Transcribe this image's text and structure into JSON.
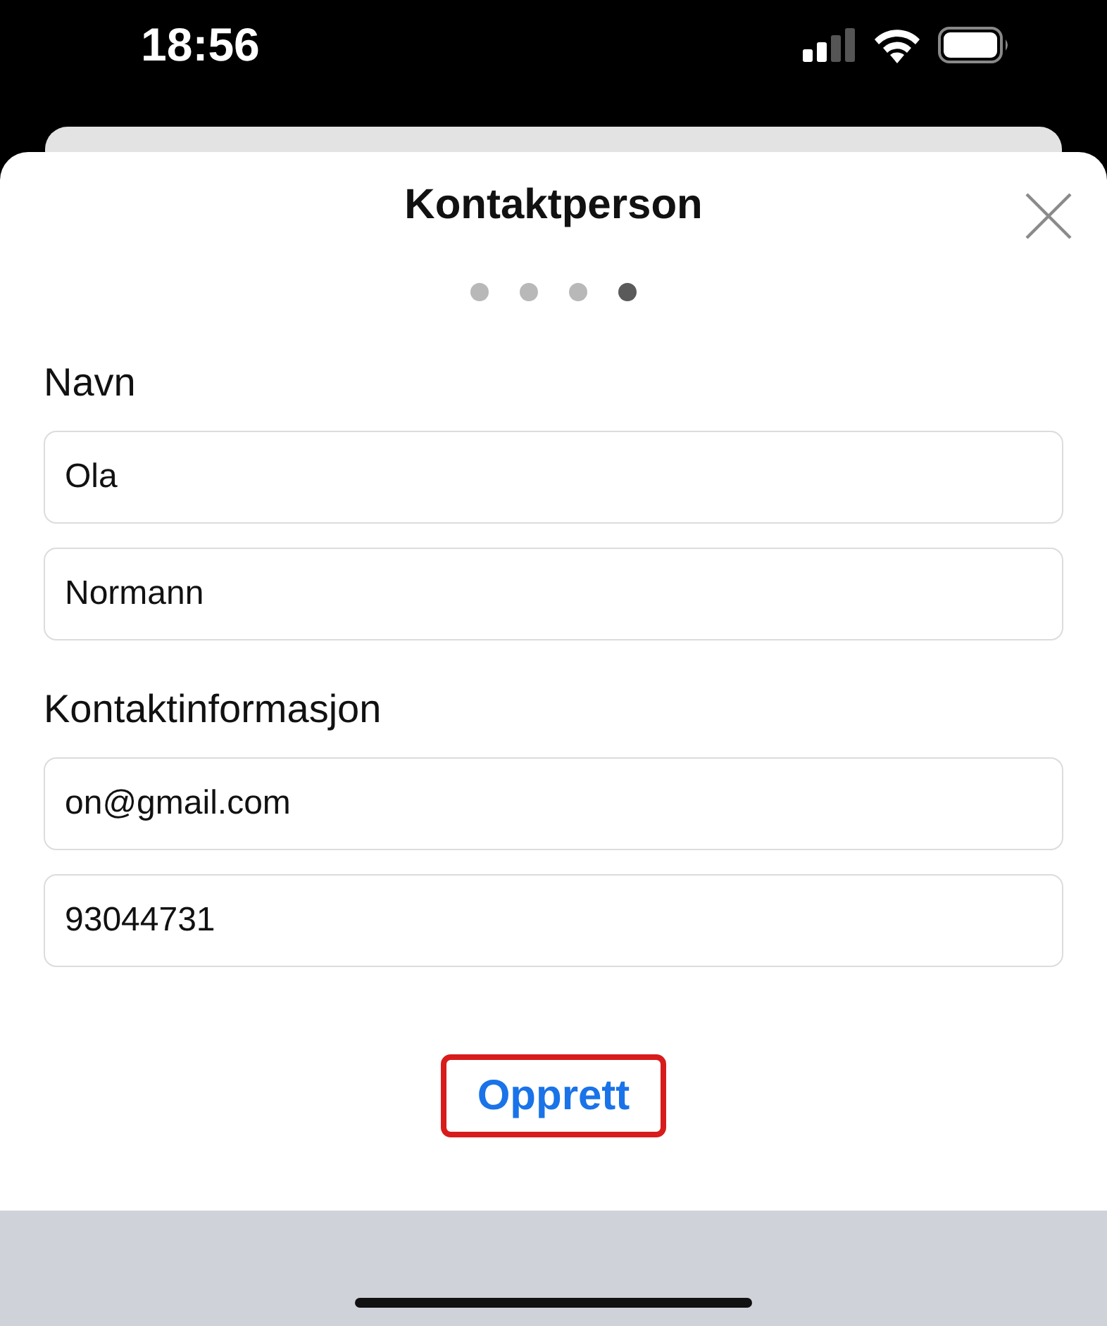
{
  "status_bar": {
    "time": "18:56"
  },
  "sheet": {
    "title": "Kontaktperson",
    "steps": [
      {
        "selected": false
      },
      {
        "selected": false
      },
      {
        "selected": false
      },
      {
        "selected": true
      }
    ],
    "sections": [
      {
        "label": "Navn",
        "fields": [
          {
            "value": "Ola"
          },
          {
            "value": "Normann"
          }
        ]
      },
      {
        "label": "Kontaktinformasjon",
        "fields": [
          {
            "value": "on@gmail.com"
          },
          {
            "value": "93044731"
          }
        ]
      }
    ],
    "submit": {
      "label": "Opprett",
      "highlighted": true
    }
  }
}
